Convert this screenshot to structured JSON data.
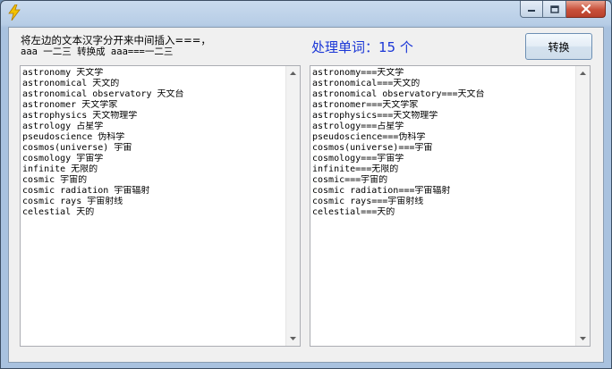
{
  "window": {
    "icon": "lightning-icon",
    "controls": {
      "minimize": "minimize-icon",
      "maximize": "maximize-icon",
      "close": "close-icon"
    }
  },
  "instruction": {
    "line1": "将左边的文本汉字分开来中间插入===，",
    "line2": "aaa 一二三 转换成 aaa===一二三"
  },
  "status": {
    "processed_label": "处理单词：15 个"
  },
  "convert_button": {
    "label": "转换"
  },
  "input_lines": [
    "astronomy 天文学",
    "astronomical 天文的",
    "astronomical observatory 天文台",
    "astronomer 天文学家",
    "astrophysics 天文物理学",
    "astrology 占星学",
    "pseudoscience 伪科学",
    "cosmos(universe) 宇宙",
    "cosmology 宇宙学",
    "infinite 无限的",
    "cosmic 宇宙的",
    "cosmic radiation 宇宙辐射",
    "cosmic rays 宇宙射线",
    "celestial 天的"
  ],
  "output_lines": [
    "astronomy===天文学",
    "astronomical===天文的",
    "astronomical observatory===天文台",
    "astronomer===天文学家",
    "astrophysics===天文物理学",
    "astrology===占星学",
    "pseudoscience===伪科学",
    "cosmos(universe)===宇宙",
    "cosmology===宇宙学",
    "infinite===无限的",
    "cosmic===宇宙的",
    "cosmic radiation===宇宙辐射",
    "cosmic rays===宇宙射线",
    "celestial===天的"
  ],
  "colors": {
    "accent_text": "#1a36d6",
    "title_bar": "#b7cde6",
    "close_button": "#c8503a"
  }
}
